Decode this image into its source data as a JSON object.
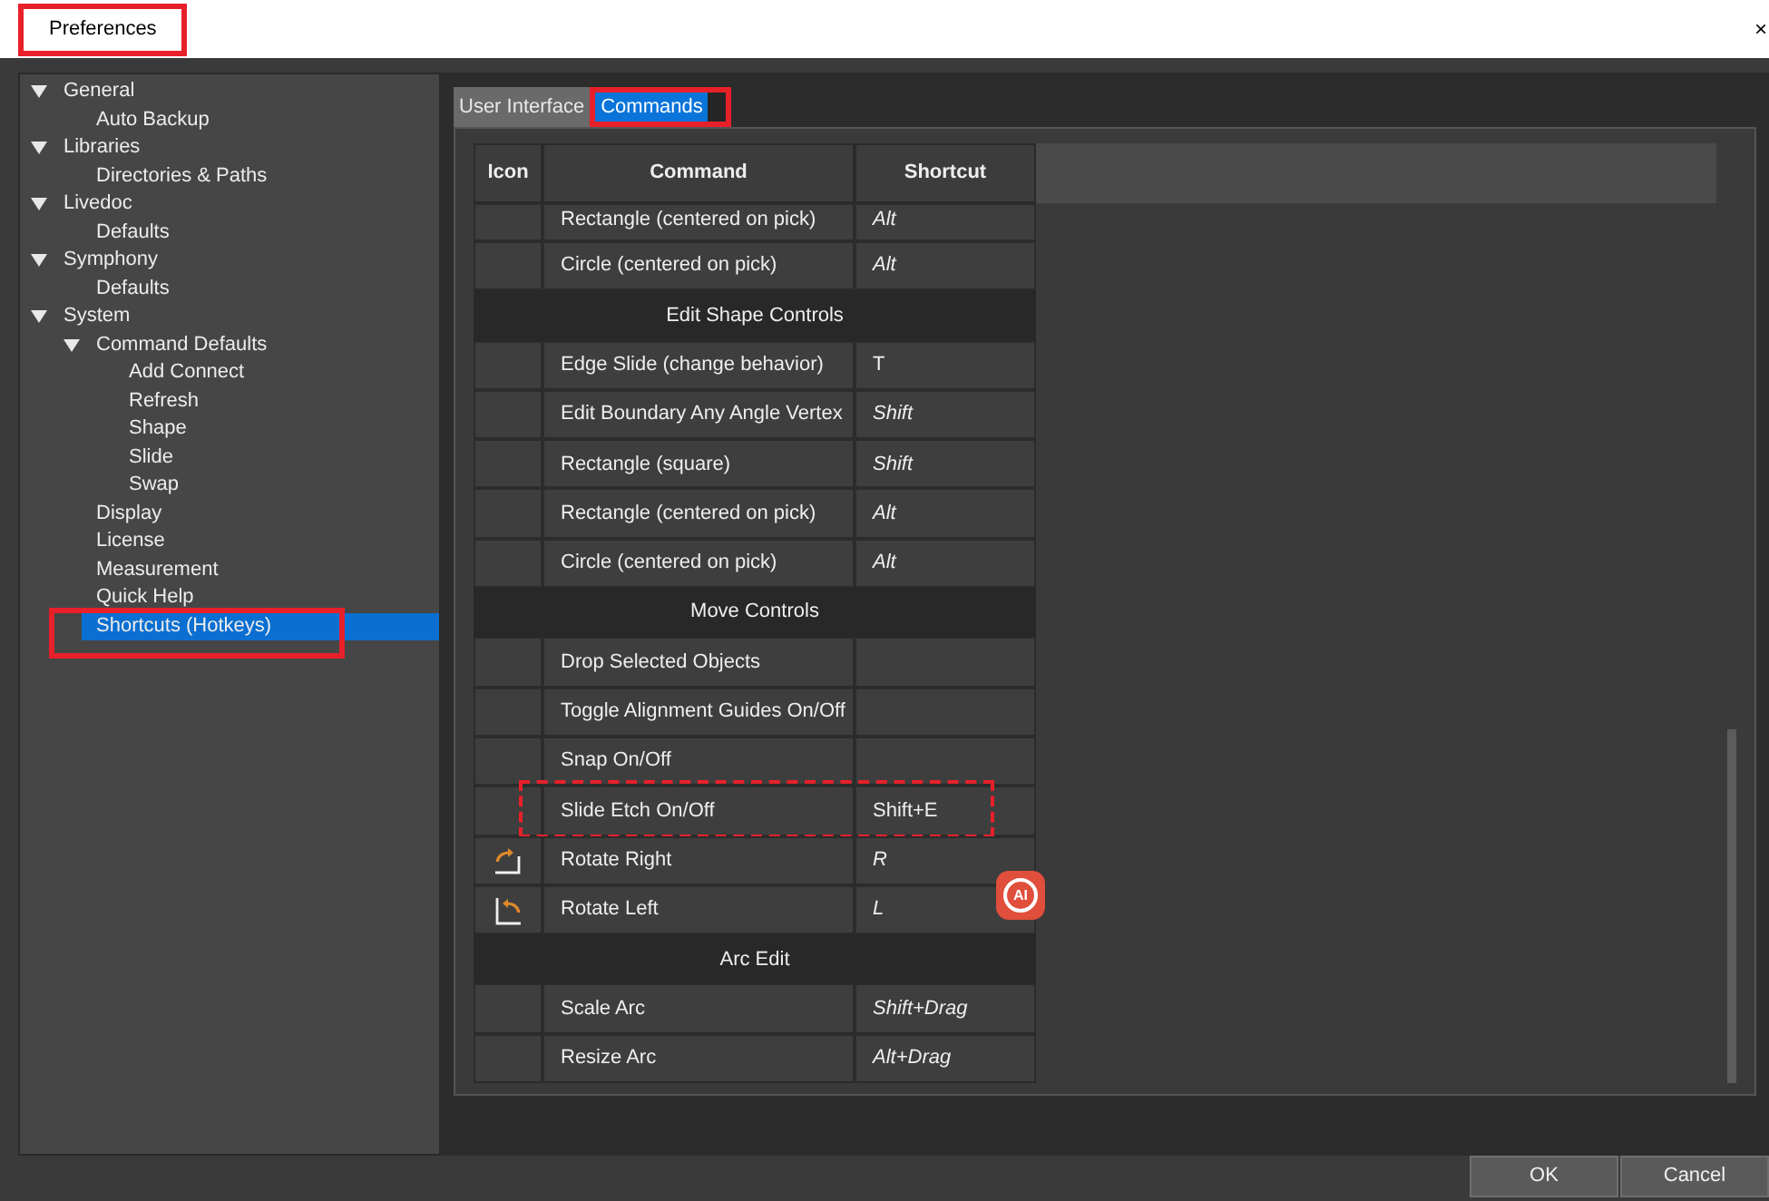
{
  "window": {
    "title": "Preferences",
    "title_annotated": true,
    "close": "×"
  },
  "sidebar": {
    "items": [
      {
        "label": "General",
        "expanded": true,
        "selected": false,
        "annotated": false,
        "children": [
          {
            "label": "Auto Backup",
            "selected": false,
            "annotated": false
          }
        ]
      },
      {
        "label": "Libraries",
        "expanded": true,
        "selected": false,
        "annotated": false,
        "children": [
          {
            "label": "Directories & Paths",
            "selected": false,
            "annotated": false
          }
        ]
      },
      {
        "label": "Livedoc",
        "expanded": true,
        "selected": false,
        "annotated": false,
        "children": [
          {
            "label": "Defaults",
            "selected": false,
            "annotated": false
          }
        ]
      },
      {
        "label": "Symphony",
        "expanded": true,
        "selected": false,
        "annotated": false,
        "children": [
          {
            "label": "Defaults",
            "selected": false,
            "annotated": false
          }
        ]
      },
      {
        "label": "System",
        "expanded": true,
        "selected": false,
        "annotated": false,
        "children": [
          {
            "label": "Command Defaults",
            "expanded": true,
            "selected": false,
            "annotated": false,
            "children": [
              {
                "label": "Add Connect",
                "selected": false,
                "annotated": false
              },
              {
                "label": "Refresh",
                "selected": false,
                "annotated": false
              },
              {
                "label": "Shape",
                "selected": false,
                "annotated": false
              },
              {
                "label": "Slide",
                "selected": false,
                "annotated": false
              },
              {
                "label": "Swap",
                "selected": false,
                "annotated": false
              }
            ]
          },
          {
            "label": "Display",
            "selected": false,
            "annotated": false
          },
          {
            "label": "License",
            "selected": false,
            "annotated": false
          },
          {
            "label": "Measurement",
            "selected": false,
            "annotated": false
          },
          {
            "label": "Quick Help",
            "selected": false,
            "annotated": false
          },
          {
            "label": "Shortcuts (Hotkeys)",
            "selected": true,
            "annotated": true
          }
        ]
      }
    ]
  },
  "tabs": [
    {
      "label": "User Interface",
      "selected": false,
      "annotated": false
    },
    {
      "label": "Commands",
      "selected": true,
      "annotated": true
    }
  ],
  "table": {
    "columns": [
      "Icon",
      "Command",
      "Shortcut"
    ],
    "rows": [
      {
        "kind": "command",
        "command": "Rectangle (centered on pick)",
        "shortcut": "Alt",
        "italic": true,
        "annotated": false
      },
      {
        "kind": "command",
        "command": "Circle (centered on pick)",
        "shortcut": "Alt",
        "italic": true,
        "annotated": false
      },
      {
        "kind": "section",
        "label": "Edit Shape Controls"
      },
      {
        "kind": "command",
        "command": "Edge Slide (change behavior)",
        "shortcut": "T",
        "italic": false,
        "annotated": false
      },
      {
        "kind": "command",
        "command": "Edit Boundary Any Angle Vertex",
        "shortcut": "Shift",
        "italic": true,
        "annotated": false
      },
      {
        "kind": "command",
        "command": "Rectangle (square)",
        "shortcut": "Shift",
        "italic": true,
        "annotated": false
      },
      {
        "kind": "command",
        "command": "Rectangle (centered on pick)",
        "shortcut": "Alt",
        "italic": true,
        "annotated": false
      },
      {
        "kind": "command",
        "command": "Circle (centered on pick)",
        "shortcut": "Alt",
        "italic": true,
        "annotated": false
      },
      {
        "kind": "section",
        "label": "Move Controls"
      },
      {
        "kind": "command",
        "command": "Drop Selected Objects",
        "annotated": false
      },
      {
        "kind": "command",
        "command": "Toggle Alignment Guides On/Off",
        "annotated": false
      },
      {
        "kind": "command",
        "command": "Snap On/Off",
        "annotated": false
      },
      {
        "kind": "command",
        "command": "Slide Etch On/Off",
        "shortcut": "Shift+E",
        "italic": false,
        "annotated": true
      },
      {
        "kind": "rotate_right",
        "command": "Rotate Right",
        "shortcut": "R",
        "italic": true,
        "annotated": false
      },
      {
        "kind": "rotate_left",
        "command": "Rotate Left",
        "shortcut": "L",
        "italic": true,
        "annotated": false
      },
      {
        "kind": "section",
        "label": "Arc Edit"
      },
      {
        "kind": "command",
        "command": "Scale Arc",
        "shortcut": "Shift+Drag",
        "italic": true,
        "annotated": false
      },
      {
        "kind": "command",
        "command": "Resize Arc",
        "shortcut": "Alt+Drag",
        "italic": true,
        "annotated": false
      }
    ]
  },
  "ai_badge": {
    "label": "AI"
  },
  "buttons": [
    "OK",
    "Cancel"
  ]
}
